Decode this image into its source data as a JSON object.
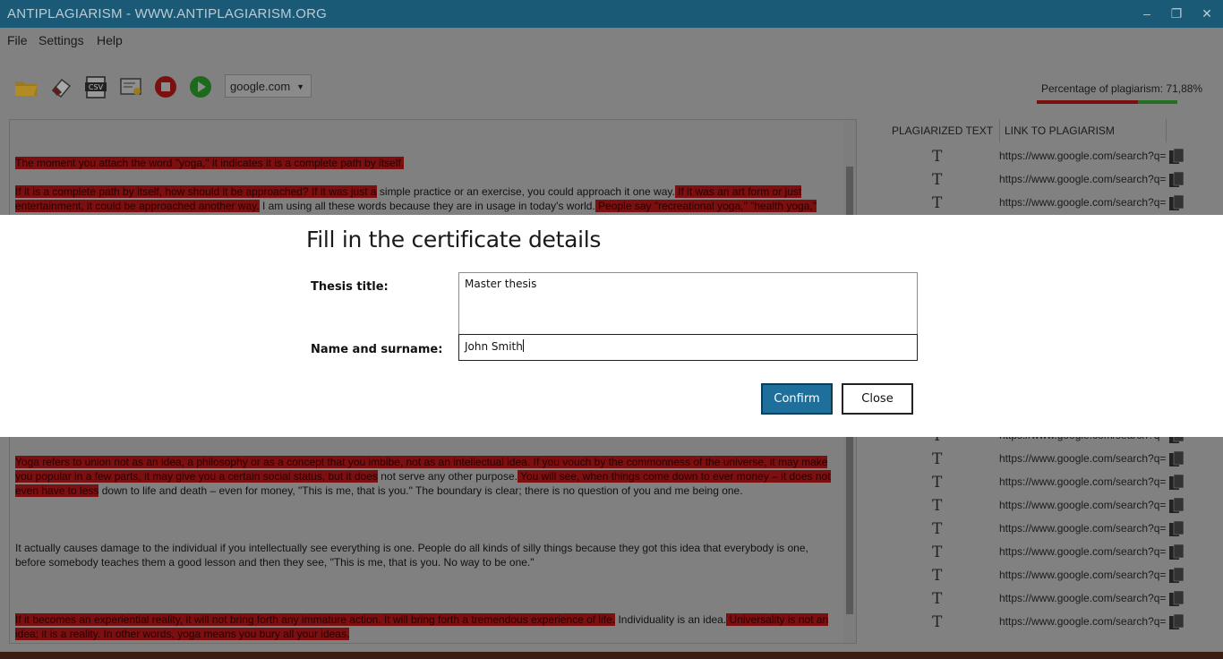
{
  "window": {
    "title": "ANTIPLAGIARISM - WWW.ANTIPLAGIARISM.ORG",
    "minimize": "–",
    "maximize": "❐",
    "close": "✕"
  },
  "menu": [
    "File",
    "Settings",
    "Help"
  ],
  "toolbar": {
    "icons": [
      "open-folder-icon",
      "eraser-icon",
      "csv-export-icon",
      "certificate-icon",
      "stop-icon",
      "play-icon"
    ],
    "search_engine": "google.com"
  },
  "plagiarism": {
    "label": "Percentage of plagiarism: 71,88%",
    "percent": 71.88
  },
  "editor": {
    "paragraphs": [
      [
        {
          "t": "The moment you attach the word \"yoga,\" it indicates it is a complete path by itself.",
          "h": true
        }
      ],
      [
        {
          "t": "If it is a complete path by itself, how should it be approached? If it was just a",
          "h": true
        },
        {
          "t": " simple practice or an exercise, you could approach it one way.",
          "h": false
        },
        {
          "t": " If it was an art form or just entertainment, it could be approached another way.",
          "h": true
        },
        {
          "t": " I am using all these words because they are in usage in today's world.",
          "h": false
        },
        {
          "t": " People say \"recreational yoga,\" \"health yoga,\"",
          "h": true
        }
      ],
      [
        {
          "t": "Yoga refers to union not as an idea, a philosophy or as a concept that you imbibe, not as an intellectual idea. If you vouch by the commonness of the universe, it may make you popular in a few parts, it may give you a certain social status, but it does",
          "h": true
        },
        {
          "t": " not serve any other purpose.",
          "h": false
        },
        {
          "t": " You will see, when things come down to ever money – it does not even have to less",
          "h": true
        },
        {
          "t": " down to life and death – even for money, \"This is me, that is you.\" The boundary is clear; there is no question of you and me being one.",
          "h": false
        }
      ],
      [
        {
          "t": "It actually causes damage to the individual if you intellectually see everything is one. People do all kinds of silly things because they got this idea that everybody is one, before somebody teaches them a good lesson and then they see, \"This is me, that is you. No way to be one.\"",
          "h": false
        }
      ],
      [
        {
          "t": "If it becomes an experiential reality, it will not bring forth any immature action.",
          "h": true
        },
        {
          "t": " It will bring forth a tremendous experience of life.",
          "h": true
        },
        {
          "t": " Individuality is an idea.",
          "h": false
        },
        {
          "t": " Universality is not an idea; it is a reality.",
          "h": true
        },
        {
          "t": " In other words, yoga means you bury all your ideas.",
          "h": true
        }
      ]
    ]
  },
  "results": {
    "headers": [
      "PLAGIARIZED TEXT",
      "LINK TO PLAGIARISM"
    ],
    "link": "https://www.google.com/search?q=",
    "row_icon": "T"
  },
  "dialog": {
    "title": "Fill in the certificate details",
    "thesis_label": "Thesis title:",
    "thesis_value": "Master thesis",
    "name_label": "Name and surname:",
    "name_value": "John Smith",
    "confirm": "Confirm",
    "close": "Close"
  },
  "colors": {
    "titlebar": "#1b5a76",
    "highlight": "#7c0f0f",
    "primary_button": "#1e6f9b"
  }
}
